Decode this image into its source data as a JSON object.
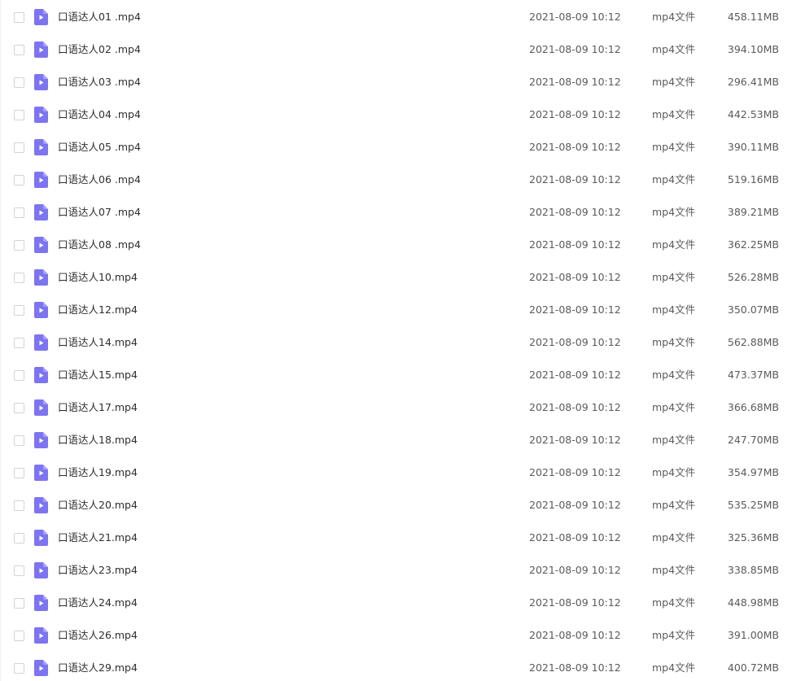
{
  "colors": {
    "icon_top": "#a7a0fb",
    "icon_bottom": "#7d74f2",
    "icon_play": "#ffffff",
    "name_text": "#2e2e2e",
    "meta_text": "#5a5a5a",
    "checkbox_border": "#cfd3dc"
  },
  "files": [
    {
      "name": "口语达人01 .mp4",
      "date": "2021-08-09 10:12",
      "type": "mp4文件",
      "size": "458.11MB",
      "icon": "video-file-icon"
    },
    {
      "name": "口语达人02 .mp4",
      "date": "2021-08-09 10:12",
      "type": "mp4文件",
      "size": "394.10MB",
      "icon": "video-file-icon"
    },
    {
      "name": "口语达人03 .mp4",
      "date": "2021-08-09 10:12",
      "type": "mp4文件",
      "size": "296.41MB",
      "icon": "video-file-icon"
    },
    {
      "name": "口语达人04 .mp4",
      "date": "2021-08-09 10:12",
      "type": "mp4文件",
      "size": "442.53MB",
      "icon": "video-file-icon"
    },
    {
      "name": "口语达人05 .mp4",
      "date": "2021-08-09 10:12",
      "type": "mp4文件",
      "size": "390.11MB",
      "icon": "video-file-icon"
    },
    {
      "name": "口语达人06 .mp4",
      "date": "2021-08-09 10:12",
      "type": "mp4文件",
      "size": "519.16MB",
      "icon": "video-file-icon"
    },
    {
      "name": "口语达人07 .mp4",
      "date": "2021-08-09 10:12",
      "type": "mp4文件",
      "size": "389.21MB",
      "icon": "video-file-icon"
    },
    {
      "name": "口语达人08 .mp4",
      "date": "2021-08-09 10:12",
      "type": "mp4文件",
      "size": "362.25MB",
      "icon": "video-file-icon"
    },
    {
      "name": "口语达人10.mp4",
      "date": "2021-08-09 10:12",
      "type": "mp4文件",
      "size": "526.28MB",
      "icon": "video-file-icon"
    },
    {
      "name": "口语达人12.mp4",
      "date": "2021-08-09 10:12",
      "type": "mp4文件",
      "size": "350.07MB",
      "icon": "video-file-icon"
    },
    {
      "name": "口语达人14.mp4",
      "date": "2021-08-09 10:12",
      "type": "mp4文件",
      "size": "562.88MB",
      "icon": "video-file-icon"
    },
    {
      "name": "口语达人15.mp4",
      "date": "2021-08-09 10:12",
      "type": "mp4文件",
      "size": "473.37MB",
      "icon": "video-file-icon"
    },
    {
      "name": "口语达人17.mp4",
      "date": "2021-08-09 10:12",
      "type": "mp4文件",
      "size": "366.68MB",
      "icon": "video-file-icon"
    },
    {
      "name": "口语达人18.mp4",
      "date": "2021-08-09 10:12",
      "type": "mp4文件",
      "size": "247.70MB",
      "icon": "video-file-icon"
    },
    {
      "name": "口语达人19.mp4",
      "date": "2021-08-09 10:12",
      "type": "mp4文件",
      "size": "354.97MB",
      "icon": "video-file-icon"
    },
    {
      "name": "口语达人20.mp4",
      "date": "2021-08-09 10:12",
      "type": "mp4文件",
      "size": "535.25MB",
      "icon": "video-file-icon"
    },
    {
      "name": "口语达人21.mp4",
      "date": "2021-08-09 10:12",
      "type": "mp4文件",
      "size": "325.36MB",
      "icon": "video-file-icon"
    },
    {
      "name": "口语达人23.mp4",
      "date": "2021-08-09 10:12",
      "type": "mp4文件",
      "size": "338.85MB",
      "icon": "video-file-icon"
    },
    {
      "name": "口语达人24.mp4",
      "date": "2021-08-09 10:12",
      "type": "mp4文件",
      "size": "448.98MB",
      "icon": "video-file-icon"
    },
    {
      "name": "口语达人26.mp4",
      "date": "2021-08-09 10:12",
      "type": "mp4文件",
      "size": "391.00MB",
      "icon": "video-file-icon"
    },
    {
      "name": "口语达人29.mp4",
      "date": "2021-08-09 10:12",
      "type": "mp4文件",
      "size": "400.72MB",
      "icon": "video-file-icon"
    }
  ]
}
